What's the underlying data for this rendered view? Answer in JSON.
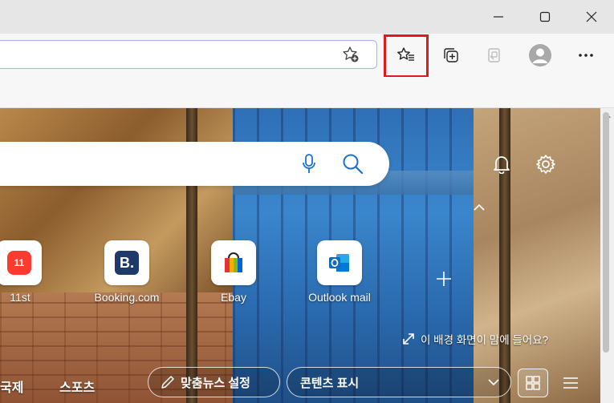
{
  "window": {
    "controls": [
      "minimize-icon",
      "maximize-icon",
      "close-icon"
    ]
  },
  "toolbar": {
    "icons": [
      "add-favorite-icon",
      "favorites-icon",
      "collections-icon",
      "browser-essentials-icon",
      "profile-icon",
      "more-icon"
    ],
    "highlight_color": "#e0191b"
  },
  "ntp": {
    "search": {
      "value": ""
    },
    "quick_links": [
      {
        "label": "11st",
        "icon": "11st-icon",
        "color": "#ff3b30"
      },
      {
        "label": "Booking.com",
        "icon": "booking-icon",
        "color": "#1e3a6b"
      },
      {
        "label": "Ebay",
        "icon": "ebay-bag-icon",
        "color": "#e53238"
      },
      {
        "label": "Outlook mail",
        "icon": "outlook-icon",
        "color": "#0f6cbd"
      }
    ],
    "bg_feedback": "이 배경 화면이 맘에 들어요?",
    "nav": {
      "item_international": "국제",
      "item_sports": "스포츠",
      "personalize_label": "맞춤뉴스 설정",
      "content_label": "콘텐츠 표시"
    }
  }
}
